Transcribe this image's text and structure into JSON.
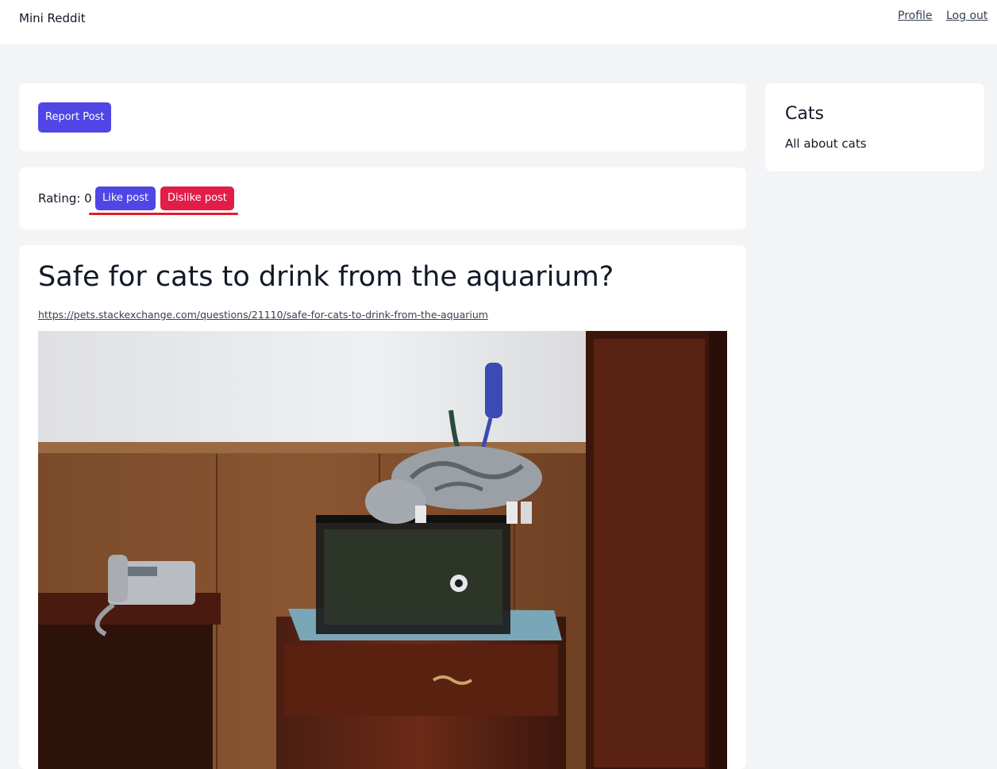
{
  "header": {
    "brand": "Mini Reddit",
    "profile_label": "Profile",
    "logout_label": "Log out"
  },
  "actions": {
    "report_label": "Report Post"
  },
  "rating": {
    "label": "Rating: 0",
    "like_label": "Like post",
    "dislike_label": "Dislike post"
  },
  "post": {
    "title": "Safe for cats to drink from the aquarium?",
    "link": "https://pets.stackexchange.com/questions/21110/safe-for-cats-to-drink-from-the-aquarium",
    "image_alt": "Cat standing on top of an aquarium"
  },
  "subreddit": {
    "name": "Cats",
    "description": "All about cats"
  },
  "colors": {
    "primary": "#4f46e5",
    "danger": "#e11d48",
    "annotation": "#e11d2a",
    "page_bg": "#f3f4f6"
  }
}
